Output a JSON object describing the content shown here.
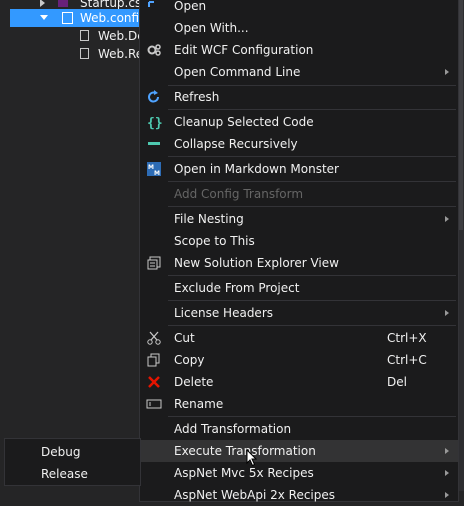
{
  "tree": {
    "items": [
      {
        "label": "Startup.cs"
      },
      {
        "label": "Web.config"
      },
      {
        "label": "Web.De"
      },
      {
        "label": "Web.Re"
      }
    ]
  },
  "menu": {
    "items": [
      {
        "label": "Open",
        "icon": "open-icon"
      },
      {
        "label": "Open With..."
      },
      {
        "label": "Edit WCF Configuration",
        "icon": "wcf-gear-icon"
      },
      {
        "label": "Open Command Line",
        "submenu": true
      },
      {
        "label": "Refresh",
        "icon": "refresh-icon"
      },
      {
        "label": "Cleanup Selected Code",
        "icon": "braces-icon"
      },
      {
        "label": "Collapse Recursively",
        "icon": "collapse-icon"
      },
      {
        "label": "Open in Markdown Monster",
        "icon": "markdown-monster-icon"
      },
      {
        "label": "Add Config Transform",
        "disabled": true
      },
      {
        "label": "File Nesting",
        "submenu": true
      },
      {
        "label": "Scope to This"
      },
      {
        "label": "New Solution Explorer View",
        "icon": "new-explorer-view-icon"
      },
      {
        "label": "Exclude From Project"
      },
      {
        "label": "License Headers",
        "submenu": true
      },
      {
        "label": "Cut",
        "shortcut": "Ctrl+X",
        "icon": "scissors-icon"
      },
      {
        "label": "Copy",
        "shortcut": "Ctrl+C",
        "icon": "copy-icon"
      },
      {
        "label": "Delete",
        "shortcut": "Del",
        "icon": "delete-x-icon"
      },
      {
        "label": "Rename",
        "icon": "rename-icon"
      },
      {
        "label": "Add Transformation"
      },
      {
        "label": "Execute Transformation",
        "submenu": true,
        "hover": true
      },
      {
        "label": "AspNet Mvc 5x Recipes",
        "submenu": true
      },
      {
        "label": "AspNet WebApi 2x Recipes",
        "submenu": true
      }
    ]
  },
  "submenu": {
    "items": [
      {
        "label": "Debug"
      },
      {
        "label": "Release"
      }
    ]
  },
  "colors": {
    "menu_bg": "#1b1b1c",
    "selection": "#3399ff",
    "hover": "#333334",
    "disabled_text": "#656565",
    "accent_blue": "#4fa3ff",
    "delete_red": "#e51400",
    "braces_green": "#4ec9b0"
  }
}
